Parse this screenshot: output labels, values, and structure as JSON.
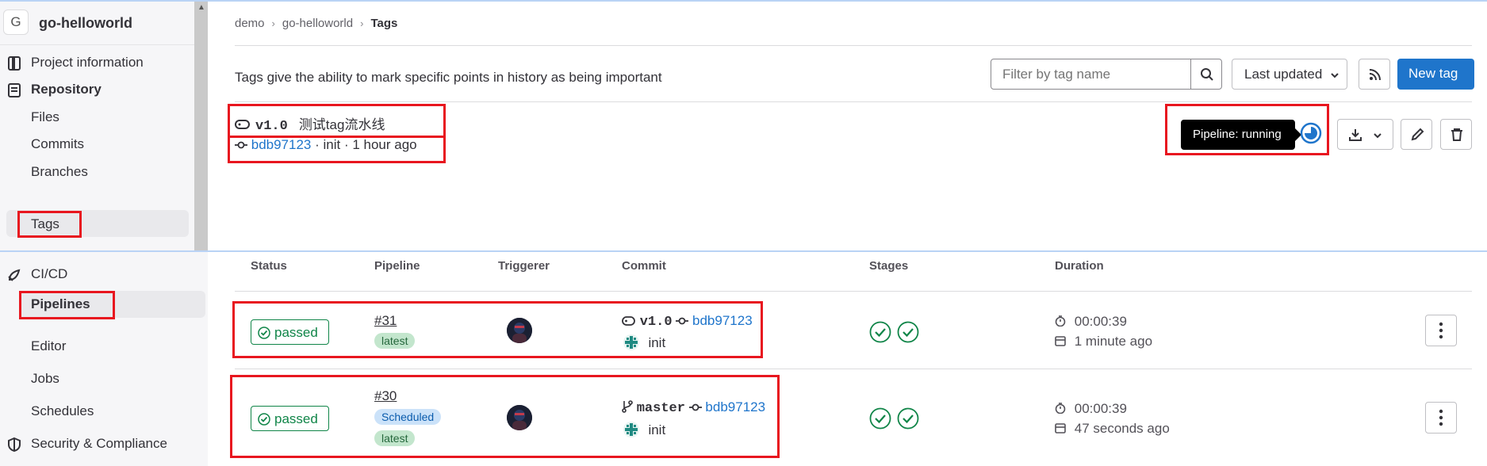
{
  "sidebar": {
    "project_initial": "G",
    "project_name": "go-helloworld",
    "items": [
      {
        "label": "Project information",
        "icon": "project-info-icon"
      },
      {
        "label": "Repository",
        "icon": "repository-icon"
      },
      {
        "label": "Files"
      },
      {
        "label": "Commits"
      },
      {
        "label": "Branches"
      },
      {
        "label": "Tags"
      },
      {
        "label": "CI/CD",
        "icon": "rocket-icon"
      },
      {
        "label": "Pipelines"
      },
      {
        "label": "Editor"
      },
      {
        "label": "Jobs"
      },
      {
        "label": "Schedules"
      },
      {
        "label": "Security & Compliance",
        "icon": "shield-icon"
      }
    ]
  },
  "breadcrumb": [
    "demo",
    "go-helloworld",
    "Tags"
  ],
  "tags_page": {
    "description": "Tags give the ability to mark specific points in history as being important",
    "filter_placeholder": "Filter by tag name",
    "sort_label": "Last updated",
    "new_tag_label": "New tag",
    "tag": {
      "name": "v1.0",
      "message": "测试tag流水线",
      "commit_sha": "bdb97123",
      "commit_info": "· init · 1 hour ago",
      "pipeline_tooltip": "Pipeline: running"
    }
  },
  "pipelines": {
    "headers": [
      "Status",
      "Pipeline",
      "Triggerer",
      "Commit",
      "Stages",
      "Duration"
    ],
    "rows": [
      {
        "status": "passed",
        "id": "#31",
        "badges": [
          "latest"
        ],
        "ref_type": "tag",
        "ref": "v1.0",
        "sha": "bdb97123",
        "message": "init",
        "duration": "00:00:39",
        "finished": "1 minute ago"
      },
      {
        "status": "passed",
        "id": "#30",
        "badges": [
          "Scheduled",
          "latest"
        ],
        "ref_type": "branch",
        "ref": "master",
        "sha": "bdb97123",
        "message": "init",
        "duration": "00:00:39",
        "finished": "47 seconds ago"
      }
    ]
  },
  "colors": {
    "accent": "#1f75cb",
    "success": "#108548",
    "highlight_box": "#e8161f"
  }
}
